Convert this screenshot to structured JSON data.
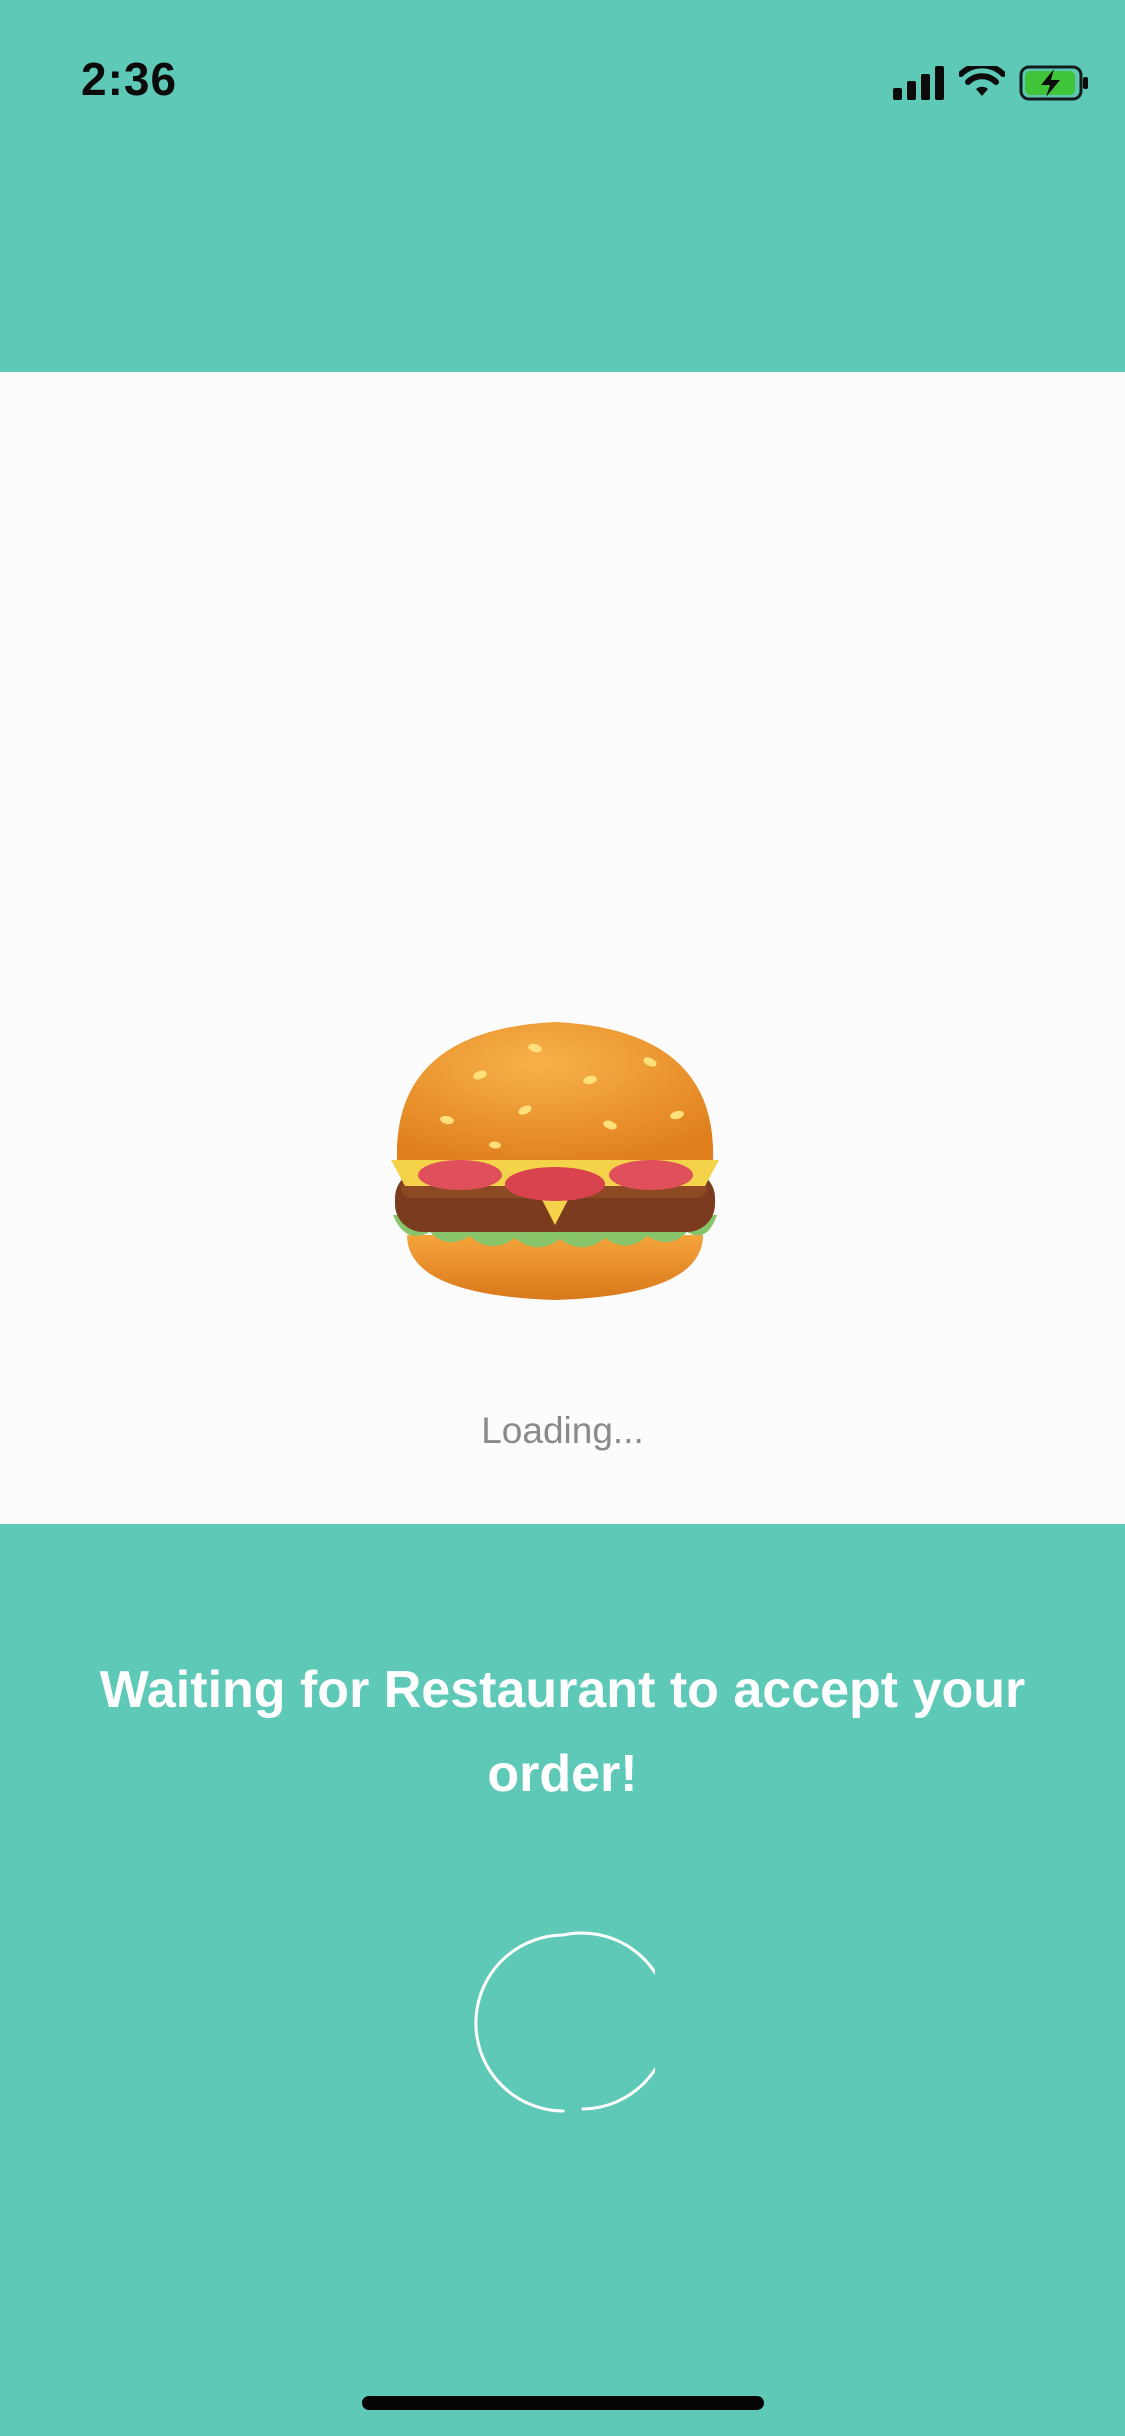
{
  "status_bar": {
    "time": "2:36",
    "icons": [
      "cellular-signal-icon",
      "wifi-icon",
      "battery-charging-icon"
    ]
  },
  "loading": {
    "image": "burger-icon",
    "label": "Loading..."
  },
  "order_status": {
    "message": "Waiting for Restaurant to accept your order!",
    "spinner": "loading-spinner"
  },
  "colors": {
    "accent": "#5fc9b8",
    "card": "#fcfcfc",
    "loading_text": "#8a8a8a",
    "message_text": "#ffffff"
  }
}
